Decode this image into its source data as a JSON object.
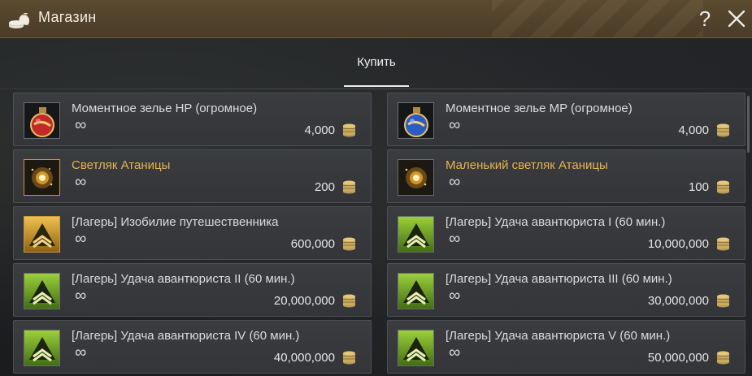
{
  "window": {
    "title": "Магазин"
  },
  "title_icons": {
    "app": "money-bag-icon",
    "help": "?",
    "close": "close-icon"
  },
  "tabs": [
    {
      "label": "Купить",
      "active": true
    }
  ],
  "colors": {
    "accent_gold": "#e8b34d",
    "titlebar": "#4e3f29",
    "panel": "#36383c"
  },
  "items": [
    {
      "name": "Моментное зелье HP (огромное)",
      "stock": "∞",
      "price": "4,000",
      "icon": "hp-potion-icon",
      "highlight": false
    },
    {
      "name": "Моментное зелье MP (огромное)",
      "stock": "∞",
      "price": "4,000",
      "icon": "mp-potion-icon",
      "highlight": false
    },
    {
      "name": "Светляк Атаницы",
      "stock": "∞",
      "price": "200",
      "icon": "firefly-icon",
      "highlight": true
    },
    {
      "name": "Маленький светляк Атаницы",
      "stock": "∞",
      "price": "100",
      "icon": "firefly-icon",
      "highlight": true
    },
    {
      "name": "[Лагерь] Изобилие путешественника",
      "stock": "∞",
      "price": "600,000",
      "icon": "camp-gold-icon",
      "highlight": false
    },
    {
      "name": "[Лагерь] Удача авантюриста I (60 мин.)",
      "stock": "∞",
      "price": "10,000,000",
      "icon": "camp-green-icon",
      "highlight": false
    },
    {
      "name": "[Лагерь] Удача авантюриста II (60 мин.)",
      "stock": "∞",
      "price": "20,000,000",
      "icon": "camp-green-icon",
      "highlight": false
    },
    {
      "name": "[Лагерь] Удача авантюриста III (60 мин.)",
      "stock": "∞",
      "price": "30,000,000",
      "icon": "camp-green-icon",
      "highlight": false
    },
    {
      "name": "[Лагерь] Удача авантюриста IV (60 мин.)",
      "stock": "∞",
      "price": "40,000,000",
      "icon": "camp-green-icon",
      "highlight": false
    },
    {
      "name": "[Лагерь] Удача авантюриста V (60 мин.)",
      "stock": "∞",
      "price": "50,000,000",
      "icon": "camp-green-icon",
      "highlight": false
    }
  ]
}
